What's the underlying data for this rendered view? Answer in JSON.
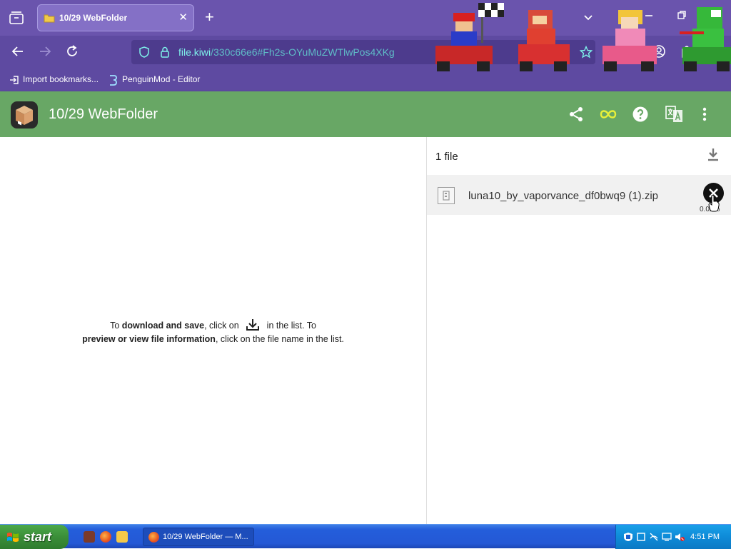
{
  "browser": {
    "tab_title": "10/29 WebFolder",
    "tab_close": "✕",
    "new_tab": "+",
    "url_host": "file.kiwi",
    "url_path": "/330c66e6#Fh2s-OYuMuZWTlwPos4XKg",
    "bookmarks": [
      {
        "label": "Import bookmarks..."
      },
      {
        "label": "PenguinMod - Editor"
      }
    ]
  },
  "app": {
    "title": "10/29 WebFolder",
    "header_icons": [
      "share-icon",
      "infinity-icon",
      "help-icon",
      "translate-icon",
      "more-vert-icon"
    ],
    "accent_color": "#68a765"
  },
  "help": {
    "part1": "To ",
    "bold1": "download and save",
    "part2": ", click on ",
    "part3": " in the list. To",
    "bold2": "preview or view file information",
    "part4": ", click on the file name in the list."
  },
  "files": {
    "count_label": "1 file",
    "items": [
      {
        "name": "luna10_by_vaporvance_df0bwq9 (1).zip",
        "progress_text": "0.02%"
      }
    ]
  },
  "taskbar": {
    "start_label": "start",
    "task_label": "10/29 WebFolder — M...",
    "clock": "4:51 PM"
  }
}
